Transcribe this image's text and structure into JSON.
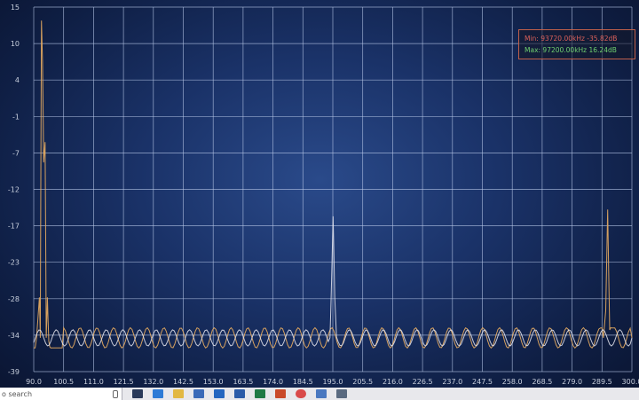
{
  "legend": {
    "min_text": "Min: 93720.00kHz -35.82dB",
    "max_text": "Max: 97200.00kHz 16.24dB",
    "min_color": "#d9605a",
    "max_color": "#6fd16f"
  },
  "taskbar": {
    "search_text": "o search"
  },
  "chart_data": {
    "type": "line",
    "xlim": [
      90.0,
      300.0
    ],
    "ylim": [
      -39,
      15
    ],
    "x_ticks": [
      "90.0",
      "100.5",
      "111.0",
      "121.5",
      "132.0",
      "142.5",
      "153.0",
      "163.5",
      "174.0",
      "184.5",
      "195.0",
      "205.5",
      "216.0",
      "226.5",
      "237.0",
      "247.5",
      "258.0",
      "268.5",
      "279.0",
      "289.5",
      "300.0"
    ],
    "y_ticks": [
      "15",
      "10",
      "4",
      "-1",
      "-7",
      "-12",
      "-17",
      "-23",
      "-28",
      "-34",
      "-39"
    ],
    "grid": true,
    "series": [
      {
        "color": "#e0a860",
        "x": [
          90.0,
          91.0,
          92.0,
          92.3,
          92.7,
          93.1,
          93.5,
          94.0,
          94.4,
          94.8,
          95.3,
          96.0,
          97.0,
          98.0,
          99.0,
          100.5,
          289.0,
          290.0,
          290.8,
          291.5,
          292.2,
          293.0,
          294.0,
          300.0
        ],
        "y": [
          -34,
          -34,
          -28,
          -34,
          13,
          7,
          -8,
          -5,
          -34,
          -28,
          -35,
          -34,
          -34,
          -34,
          -34,
          -34,
          -34,
          -34,
          -30,
          -15,
          -33,
          -34,
          -34,
          -34
        ],
        "noise_amplitude": 1.5
      },
      {
        "color": "#e8e8f0",
        "x": [
          90.0,
          194.0,
          194.6,
          195.1,
          195.7,
          196.3,
          300.0
        ],
        "y": [
          -34,
          -34,
          -25,
          -16,
          -28,
          -34,
          -34
        ],
        "noise_amplitude": 1.2
      }
    ]
  }
}
